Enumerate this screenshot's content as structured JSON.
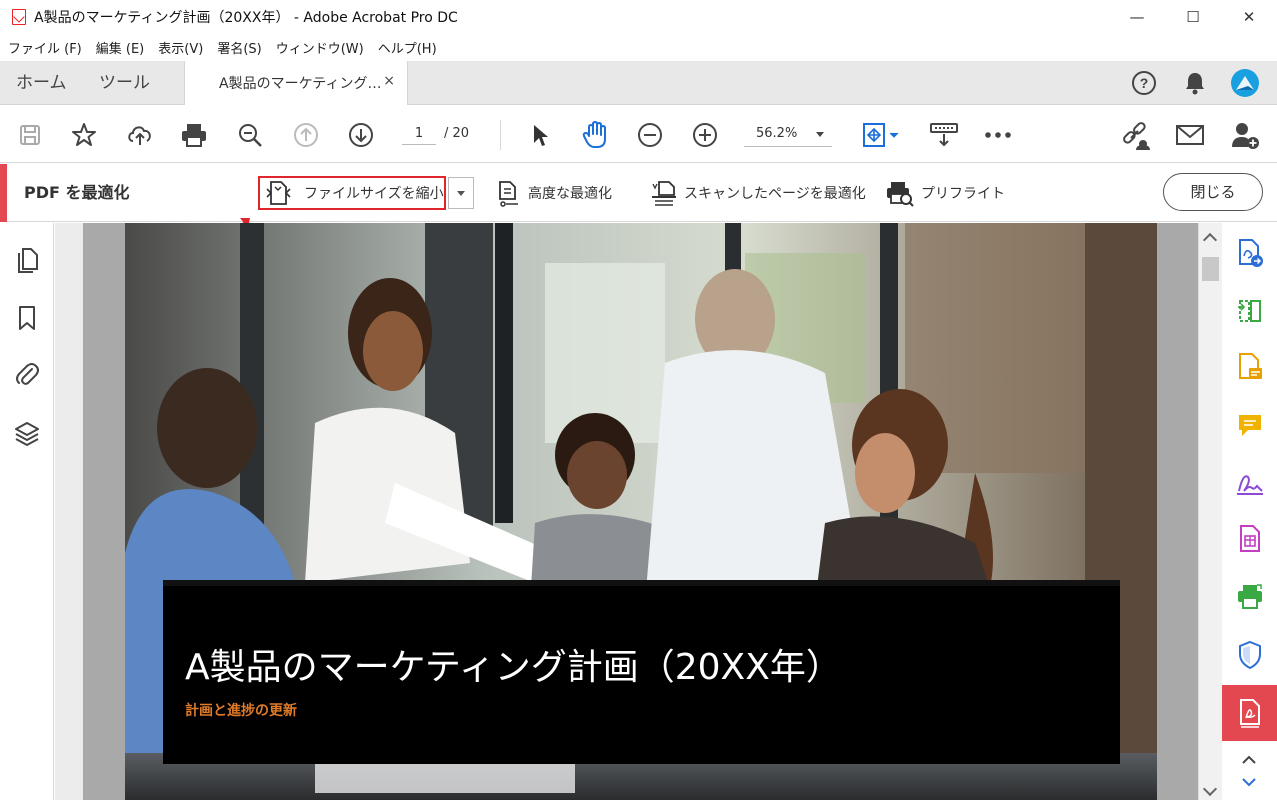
{
  "window": {
    "title": "A製品のマーケティング計画（20XX年） - Adobe Acrobat Pro DC",
    "controls": {
      "minimize": "—",
      "maximize": "☐",
      "close": "✕"
    }
  },
  "menu": [
    "ファイル (F)",
    "編集 (E)",
    "表示(V)",
    "署名(S)",
    "ウィンドウ(W)",
    "ヘルプ(H)"
  ],
  "tabs": {
    "home": "ホーム",
    "tools": "ツール",
    "document": "A製品のマーケティング…",
    "close": "×"
  },
  "toolbar": {
    "page_current": "1",
    "page_total": "/ 20",
    "zoom": "56.2%"
  },
  "optimize_bar": {
    "title": "PDF を最適化",
    "reduce_size": "ファイルサイズを縮小",
    "advanced": "高度な最適化",
    "scanned": "スキャンしたページを最適化",
    "preflight": "プリフライト",
    "close": "閉じる"
  },
  "document": {
    "title": "A製品のマーケティング計画（20XX年）",
    "subtitle": "計画と進捗の更新"
  },
  "colors": {
    "accent_red": "#e34850",
    "highlight_red": "#e0262b",
    "subtitle_orange": "#e07b2a",
    "rail_blue": "#2b6fd6"
  },
  "icons": {
    "left_rail": [
      "pages-icon",
      "bookmark-icon",
      "attachment-icon",
      "layers-icon"
    ],
    "right_rail": [
      "export-pdf-icon",
      "organize-pages-icon",
      "edit-pdf-icon",
      "comment-icon",
      "fill-sign-icon",
      "create-pdf-icon",
      "print-production-icon",
      "protect-icon",
      "optimize-pdf-icon"
    ]
  }
}
